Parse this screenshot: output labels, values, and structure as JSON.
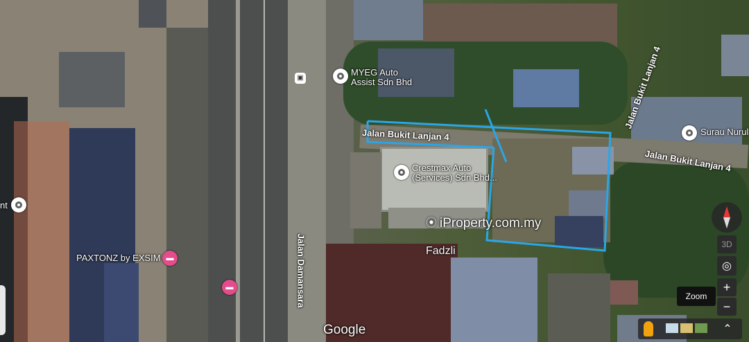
{
  "places": {
    "myeg": "MYEG Auto\nAssist Sdn Bhd",
    "crestmax": "Crestmax Auto\n(Services) Sdn Bhd...",
    "paxtonz": "PAXTONZ by EXSIM",
    "surau": "Surau Nurul",
    "left_partial": "nt"
  },
  "roads": {
    "lanjan4_main": "Jalan Bukit Lanjan 4",
    "lanjan4_right": "Jalan Bukit Lanjan 4",
    "lanjan4_top": "Jalan Bukit Lanjan 4",
    "damansara": "Jalan Damansara"
  },
  "watermark": "iProperty.com.my",
  "owner_label": "Fadzli",
  "google_logo": "Google",
  "controls": {
    "three_d": "3D",
    "zoom_tooltip": "Zoom",
    "zoom_in": "+",
    "zoom_out": "−",
    "expand": "⌃"
  },
  "colors": {
    "boundary": "#2aa6e8",
    "pin_pink": "#e44c8c"
  }
}
